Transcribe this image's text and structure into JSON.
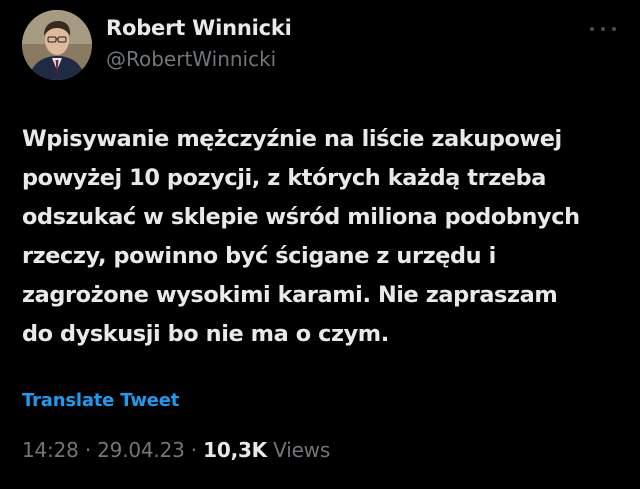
{
  "author": {
    "display_name": "Robert Winnicki",
    "handle": "@RobertWinnicki"
  },
  "tweet": {
    "text": "Wpisywanie mężczyźnie na liście zakupowej\npowyżej 10 pozycji, z których każdą trzeba\nodszukać w sklepie wśród miliona podobnych\nrzeczy, powinno być ścigane z urzędu i\nzagrożone wysokimi karami. Nie zapraszam\ndo dyskusji bo nie ma o czym.",
    "translate_label": "Translate Tweet",
    "time": "14:28",
    "date": "29.04.23",
    "separator": "·",
    "views_count": "10,3K",
    "views_label": "Views"
  },
  "icons": {
    "more": "more-options-icon"
  },
  "colors": {
    "background": "#000000",
    "primary_text": "#e7e9ea",
    "secondary_text": "#71767b",
    "link": "#1d9bf0"
  }
}
